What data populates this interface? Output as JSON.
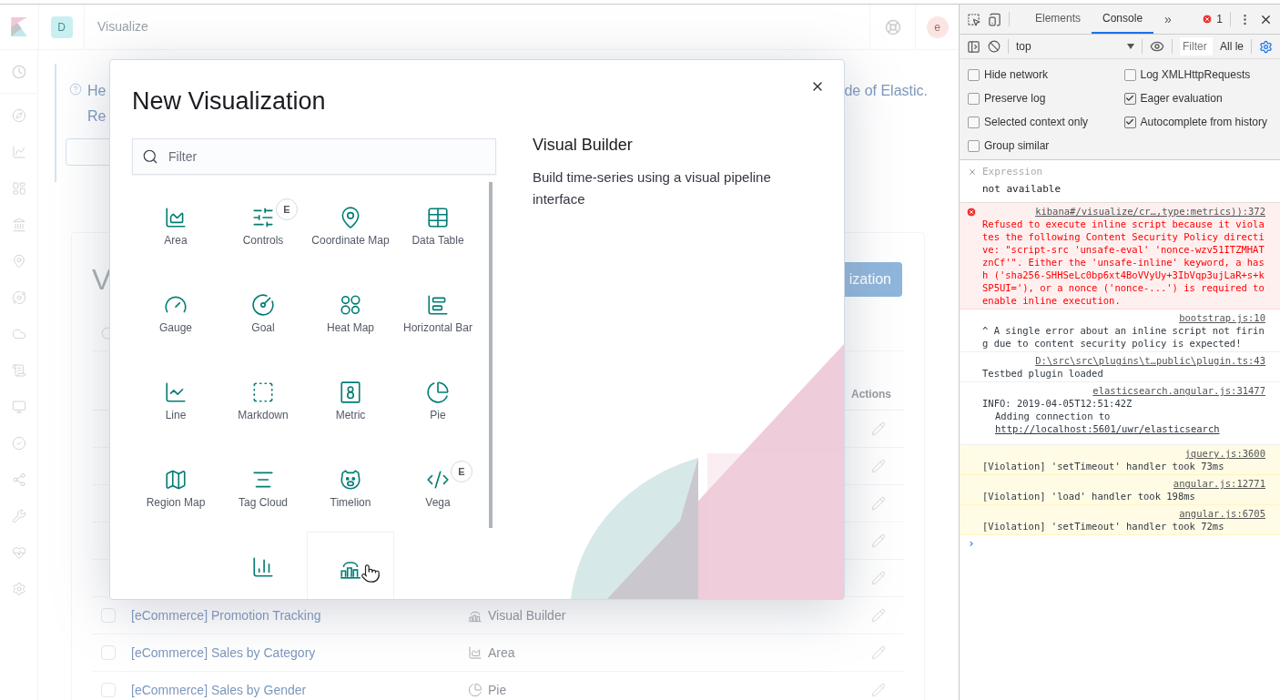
{
  "app": {
    "header": {
      "space_badge": "D",
      "title": "Visualize",
      "avatar": "e"
    },
    "callout": {
      "line_1": "He",
      "line_2": "Re",
      "line_1_end": "de of Elastic."
    },
    "heading_fragment": "V",
    "create_button_fragment": "ization",
    "table": {
      "actions_header": "Actions",
      "rows": [
        {
          "kind": "covered"
        },
        {
          "kind": "covered"
        },
        {
          "kind": "covered"
        },
        {
          "kind": "covered"
        },
        {
          "kind": "covered"
        },
        {
          "kind": "visual_builder",
          "checked": false,
          "title": "[eCommerce] Promotion Tracking",
          "type": "Visual Builder"
        },
        {
          "kind": "area",
          "checked": false,
          "title": "[eCommerce] Sales by Category",
          "type": "Area"
        },
        {
          "kind": "pie",
          "checked": false,
          "title": "[eCommerce] Sales by Gender",
          "type": "Pie"
        }
      ]
    }
  },
  "modal": {
    "title": "New Visualization",
    "filter_placeholder": "Filter",
    "types": [
      {
        "label": "Area",
        "kind": "area",
        "hovered": false
      },
      {
        "label": "Controls",
        "kind": "controls",
        "badge": "E",
        "hovered": false
      },
      {
        "label": "Coordinate Map",
        "kind": "pin",
        "hovered": false
      },
      {
        "label": "Data Table",
        "kind": "table",
        "hovered": false
      },
      {
        "label": "Gauge",
        "kind": "gauge",
        "hovered": false
      },
      {
        "label": "Goal",
        "kind": "goal",
        "hovered": false
      },
      {
        "label": "Heat Map",
        "kind": "heatmap",
        "hovered": false
      },
      {
        "label": "Horizontal Bar",
        "kind": "hbar",
        "hovered": false
      },
      {
        "label": "Line",
        "kind": "line",
        "hovered": false
      },
      {
        "label": "Markdown",
        "kind": "markdown",
        "hovered": false
      },
      {
        "label": "Metric",
        "kind": "metric",
        "hovered": false
      },
      {
        "label": "Pie",
        "kind": "pie",
        "hovered": false
      },
      {
        "label": "Region Map",
        "kind": "map",
        "hovered": false
      },
      {
        "label": "Tag Cloud",
        "kind": "tagcloud",
        "hovered": false
      },
      {
        "label": "Timelion",
        "kind": "timelion",
        "hovered": false
      },
      {
        "label": "Vega",
        "kind": "vega",
        "badge": "E",
        "hovered": false
      },
      {
        "kind": "bars",
        "hovered": false
      },
      {
        "kind": "visual_builder",
        "hovered": true
      }
    ],
    "description": {
      "title": "Visual Builder",
      "text": "Build time-series using a visual pipeline interface"
    }
  },
  "devtools": {
    "tabs": [
      {
        "label": "Elements",
        "selected": false
      },
      {
        "label": "Console",
        "selected": true
      }
    ],
    "more": "»",
    "error_count": "1",
    "context": "top",
    "filter_placeholder": "Filter",
    "levels": "All le",
    "settings": [
      {
        "label": "Hide network",
        "checked": false
      },
      {
        "label": "Log XMLHttpRequests",
        "checked": false
      },
      {
        "label": "Preserve log",
        "checked": false
      },
      {
        "label": "Eager evaluation",
        "checked": true
      },
      {
        "label": "Selected context only",
        "checked": false
      },
      {
        "label": "Autocomplete from history",
        "checked": true
      },
      {
        "label": "Group similar",
        "checked": false
      }
    ],
    "expression": {
      "label": "Expression",
      "value": "not available"
    },
    "messages": [
      {
        "kind": "error",
        "source": "kibana#/visualize/cr…,type:metrics)):372",
        "text": "Refused to execute inline script because it violates the following Content Security Policy directive: \"script-src 'unsafe-eval' 'nonce-wzv51ITZMHATznCf'\". Either the 'unsafe-inline' keyword, a hash ('sha256-SHHSeLc0bp6xt4BoVVyUy+3IbVqp3ujLaR+s+kSP5UI='), or a nonce ('nonce-...') is required to enable inline execution."
      },
      {
        "kind": "log",
        "source": "bootstrap.js:10",
        "text": "^ A single error about an inline script not firing due to content security policy is expected!"
      },
      {
        "kind": "log",
        "source": "D:\\src\\src\\plugins\\t…public\\plugin.ts:43",
        "text": "Testbed plugin loaded"
      },
      {
        "kind": "log",
        "source": "elasticsearch.angular.js:31477",
        "text": "INFO: 2019-04-05T12:51:42Z",
        "detail": "Adding connection to",
        "link": "http://localhost:5601/uwr/elasticsearch"
      },
      {
        "kind": "warning",
        "source": "jquery.js:3600",
        "text": "[Violation] 'setTimeout' handler took 73ms"
      },
      {
        "kind": "warning",
        "source": "angular.js:12771",
        "text": "[Violation] 'load' handler took 198ms"
      },
      {
        "kind": "warning",
        "source": "angular.js:6705",
        "text": "[Violation] 'setTimeout' handler took 72ms"
      }
    ],
    "prompt": "›"
  }
}
